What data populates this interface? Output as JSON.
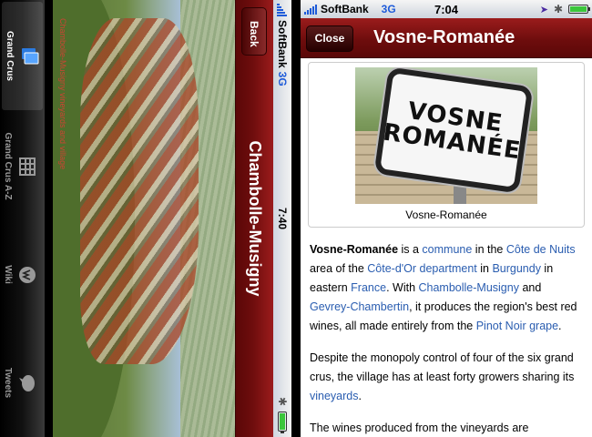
{
  "left_app": {
    "status": {
      "carrier": "SoftBank",
      "network": "3G",
      "time": "7:40"
    },
    "nav": {
      "back_label": "Back",
      "title": "Chambolle-Musigny"
    },
    "photo_caption": "Chambolle-Musigny vineyards and village",
    "tabs": [
      {
        "label": "Grand Crus",
        "icon": "grand-crus-icon",
        "active": true
      },
      {
        "label": "Grand Crus A-Z",
        "icon": "list-icon",
        "active": false
      },
      {
        "label": "Wiki",
        "icon": "wiki-icon",
        "active": false
      },
      {
        "label": "Tweets",
        "icon": "tweets-icon",
        "active": false
      }
    ]
  },
  "right_app": {
    "status": {
      "carrier": "SoftBank",
      "network": "3G",
      "time": "7:04"
    },
    "nav": {
      "close_label": "Close",
      "title": "Vosne-Romanée"
    },
    "figure": {
      "sign_line1": "VOSNE",
      "sign_line2": "ROMANÉE",
      "caption": "Vosne-Romanée"
    },
    "article": {
      "p1": {
        "t0": "Vosne-Romanée",
        "t1": " is a ",
        "l1": "commune",
        "t2": " in the ",
        "l2": "Côte de Nuits",
        "t3": " area of the ",
        "l3": "Côte-d'Or department",
        "t4": " in ",
        "l4": "Burgundy",
        "t5": " in eastern ",
        "l5": "France",
        "t6": ". With ",
        "l6": "Chambolle-Musigny",
        "t7": " and ",
        "l7": "Gevrey-Chambertin",
        "t8": ", it produces the region's best red wines, all made entirely from the ",
        "l8": "Pinot Noir grape",
        "t9": "."
      },
      "p2": {
        "t0": "Despite the monopoly control of four of the six grand crus, the village has at least forty growers sharing its ",
        "l1": "vineyards",
        "t1": "."
      },
      "p3": {
        "t0": "The wines produced from the vineyards are"
      }
    }
  },
  "colors": {
    "nav_red": "#7a1010",
    "link": "#2a5db0",
    "network_blue": "#1e5bd9"
  }
}
